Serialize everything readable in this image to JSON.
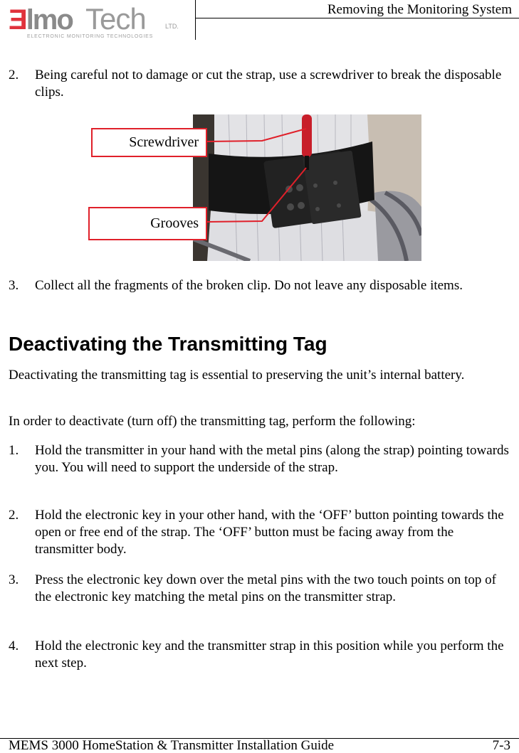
{
  "header": {
    "logo": {
      "mark_e": "Ǝ",
      "mark_rest": "lmo",
      "tech": "Tech",
      "ltd": "LTD.",
      "tagline": "ELECTRONIC MONITORING TECHNOLOGIES",
      "brand_red": "#e0323c",
      "brand_gray": "#8a8a8a"
    },
    "section_title": "Removing the Monitoring System"
  },
  "steps_removal": [
    {
      "num": "2.",
      "text": "Being careful not to damage or cut the strap, use a screwdriver to break the disposable clips."
    },
    {
      "num": "3.",
      "text": "Collect all the fragments of the broken clip. Do not leave any disposable items."
    }
  ],
  "figure": {
    "callouts": {
      "screwdriver": "Screwdriver",
      "grooves": "Grooves"
    },
    "callout_color": "#e0202a",
    "image_description": "Photo of ankle strap transmitter on a white sock with a red screwdriver inserted into the clip"
  },
  "section": {
    "heading": "Deactivating the Transmitting Tag",
    "intro": "Deactivating the transmitting tag is essential to preserving the unit’s internal battery.",
    "lead_in": "In order to deactivate (turn off) the transmitting tag, perform the following:",
    "steps": [
      {
        "num": "1.",
        "text": "Hold the transmitter in your hand with the metal pins (along the strap) pointing towards you. You will need to support the underside of the strap."
      },
      {
        "num": "2.",
        "text": "Hold the electronic key in your other hand, with the ‘OFF’ button pointing towards the open or free end of the strap. The ‘OFF’ button must be facing away from the transmitter body."
      },
      {
        "num": "3.",
        "text": "Press the electronic key down over the metal pins with the two touch points on top of the electronic key matching the metal pins on the transmitter strap."
      },
      {
        "num": "4.",
        "text": "Hold the electronic key and the transmitter strap in this position while you perform the next step."
      }
    ]
  },
  "footer": {
    "title": "MEMS 3000 HomeStation & Transmitter Installation Guide",
    "page": "7-3"
  }
}
